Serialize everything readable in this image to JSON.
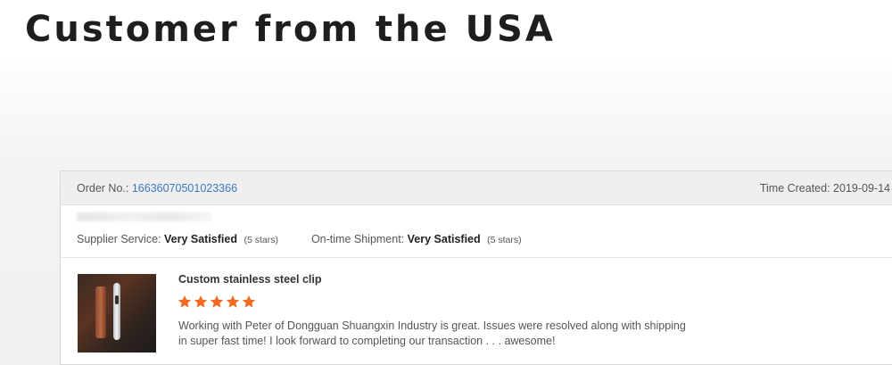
{
  "headline": "Customer from the USA",
  "order": {
    "label": "Order No.:",
    "number": "16636070501023366",
    "time_created_label": "Time Created:",
    "time_created_value": "2019-09-14"
  },
  "ratings": {
    "supplier_label": "Supplier Service:",
    "supplier_value": "Very Satisfied",
    "supplier_stars": "(5 stars)",
    "shipment_label": "On-time Shipment:",
    "shipment_value": "Very Satisfied",
    "shipment_stars": "(5 stars)"
  },
  "review": {
    "product_title": "Custom stainless steel clip",
    "rating": 5,
    "star_color": "#f26a21",
    "text": "Working with Peter of Dongguan Shuangxin Industry is great. Issues were resolved along with shipping in super fast time! I look forward to completing our transaction . . . awesome!"
  },
  "colors": {
    "link": "#3a78c2",
    "header_bg": "#efefef",
    "star": "#f26a21"
  }
}
